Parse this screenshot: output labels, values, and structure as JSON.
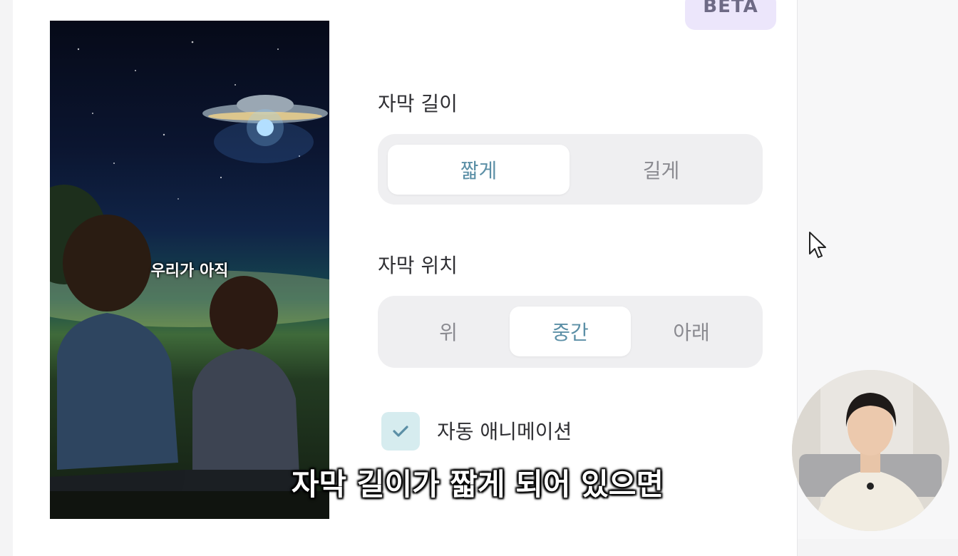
{
  "badge": {
    "label": "BETA"
  },
  "preview": {
    "caption": "우리가 아직"
  },
  "caption_length": {
    "label": "자막 길이",
    "options": [
      "짧게",
      "길게"
    ],
    "selected": "짧게"
  },
  "caption_position": {
    "label": "자막 위치",
    "options": [
      "위",
      "중간",
      "아래"
    ],
    "selected": "중간"
  },
  "auto_animation": {
    "label": "자동 애니메이션",
    "checked": true
  },
  "video_subtitle": "자막 길이가 짧게 되어 있으면",
  "colors": {
    "accent": "#5b8fa6",
    "checkbox_bg": "#d6ecef",
    "badge_bg": "#ece6fb"
  },
  "icons": {
    "checkbox": "check-icon",
    "pointer": "mouse-cursor-icon"
  }
}
